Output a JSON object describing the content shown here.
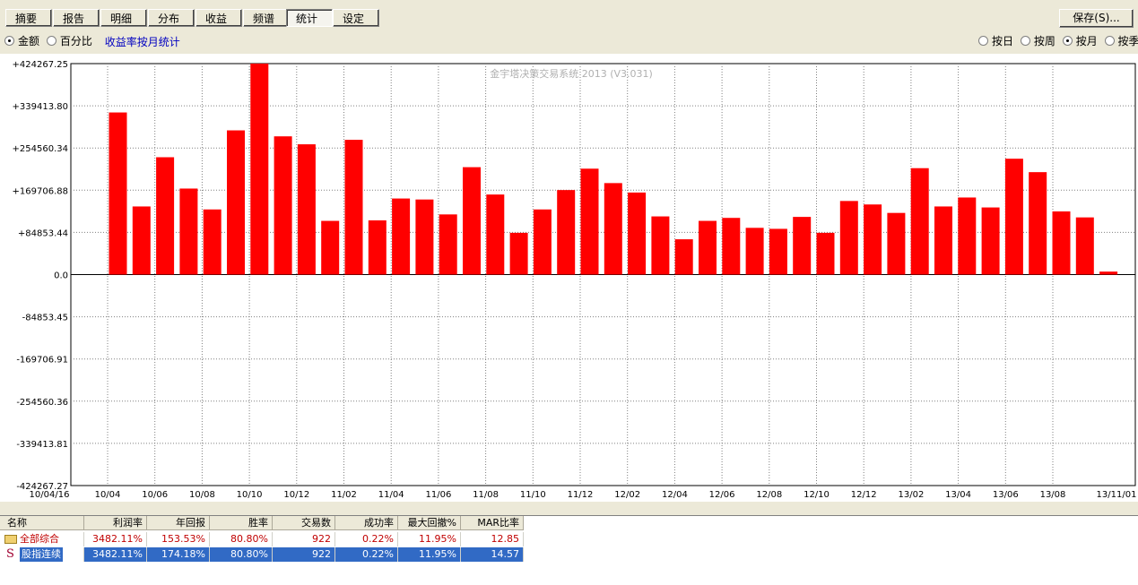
{
  "tabs": [
    "摘要",
    "报告",
    "明细",
    "分布",
    "收益",
    "频谱",
    "统计",
    "设定"
  ],
  "active_tab": 6,
  "save_label": "保存(S)...",
  "mode_options": [
    {
      "label": "金额",
      "selected": true
    },
    {
      "label": "百分比",
      "selected": false
    }
  ],
  "mode_link": "收益率按月统计",
  "period_options": [
    {
      "label": "按日",
      "selected": false
    },
    {
      "label": "按周",
      "selected": false
    },
    {
      "label": "按月",
      "selected": true
    },
    {
      "label": "按季",
      "selected": false
    }
  ],
  "chart_data": {
    "type": "bar",
    "title": "金宇塔决策交易系统 2013 (V3.031)",
    "color": "#ff0000",
    "ylim": [
      -424267.27,
      424267.25
    ],
    "y_ticks": [
      "+424267.25",
      "+339413.80",
      "+254560.34",
      "+169706.88",
      "+84853.44",
      "0.0",
      "-84853.45",
      "-169706.91",
      "-254560.36",
      "-339413.81",
      "-424267.27"
    ],
    "x_tick_labels": [
      "10/04/16",
      "10/04",
      "10/06",
      "10/08",
      "10/10",
      "10/12",
      "11/02",
      "11/04",
      "11/06",
      "11/08",
      "11/10",
      "11/12",
      "12/02",
      "12/04",
      "12/06",
      "12/08",
      "12/10",
      "12/12",
      "13/02",
      "13/04",
      "13/06",
      "13/08",
      "13/11/01"
    ],
    "values": [
      326000,
      137000,
      236000,
      173000,
      131000,
      290000,
      424267,
      278000,
      262000,
      108000,
      271000,
      109000,
      153000,
      151000,
      121000,
      216000,
      161000,
      84000,
      131000,
      170000,
      213000,
      184000,
      165000,
      117000,
      71000,
      108000,
      114000,
      94000,
      92000,
      116000,
      84000,
      148000,
      141000,
      124000,
      214000,
      137000,
      155000,
      135000,
      233000,
      206000,
      127000,
      115000,
      6000
    ]
  },
  "table": {
    "headers": [
      "名称",
      "利润率",
      "年回报",
      "胜率",
      "交易数",
      "成功率",
      "最大回撤%",
      "MAR比率"
    ],
    "rows": [
      {
        "icon": "folder-icon",
        "cells": [
          "全部综合",
          "3482.11%",
          "153.53%",
          "80.80%",
          "922",
          "0.22%",
          "11.95%",
          "12.85"
        ],
        "selected": false
      },
      {
        "icon": "s-icon",
        "icon_text": "S",
        "cells": [
          "股指连续",
          "3482.11%",
          "174.18%",
          "80.80%",
          "922",
          "0.22%",
          "11.95%",
          "14.57"
        ],
        "selected": true
      }
    ]
  }
}
